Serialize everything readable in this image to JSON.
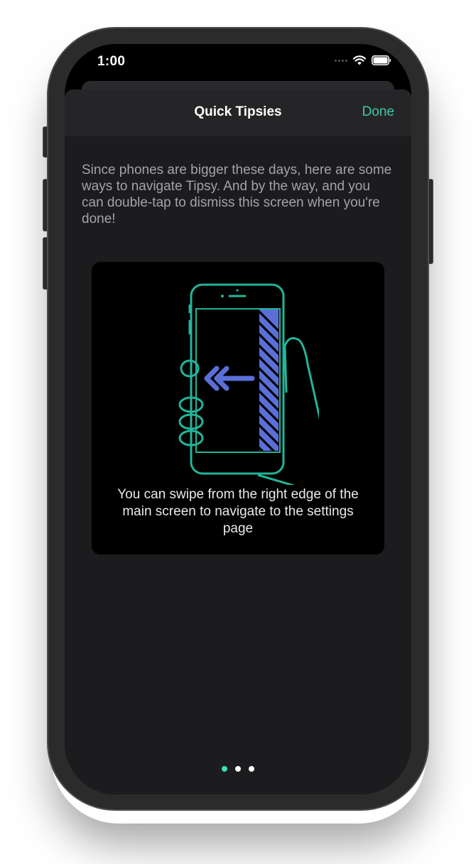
{
  "status_bar": {
    "time": "1:00",
    "icons": [
      "cellular-signal-icon",
      "wifi-icon",
      "battery-icon"
    ]
  },
  "navbar": {
    "title": "Quick Tipsies",
    "done_label": "Done"
  },
  "intro_text": "Since phones are bigger these days, here are some ways to navigate Tipsy. And by the way, and you can double-tap to dismiss this screen when you're done!",
  "tip": {
    "illustration": "swipe-from-right-edge-illustration",
    "caption": "You can swipe from the right edge of the main screen to navigate to the settings page"
  },
  "pager": {
    "total_pages": 3,
    "current_page": 1
  },
  "colors": {
    "accent": "#3ec8a8",
    "illustration_outline": "#22b59a",
    "illustration_highlight": "#5b6fd8",
    "background": "#1c1c1e",
    "card": "#000000"
  }
}
